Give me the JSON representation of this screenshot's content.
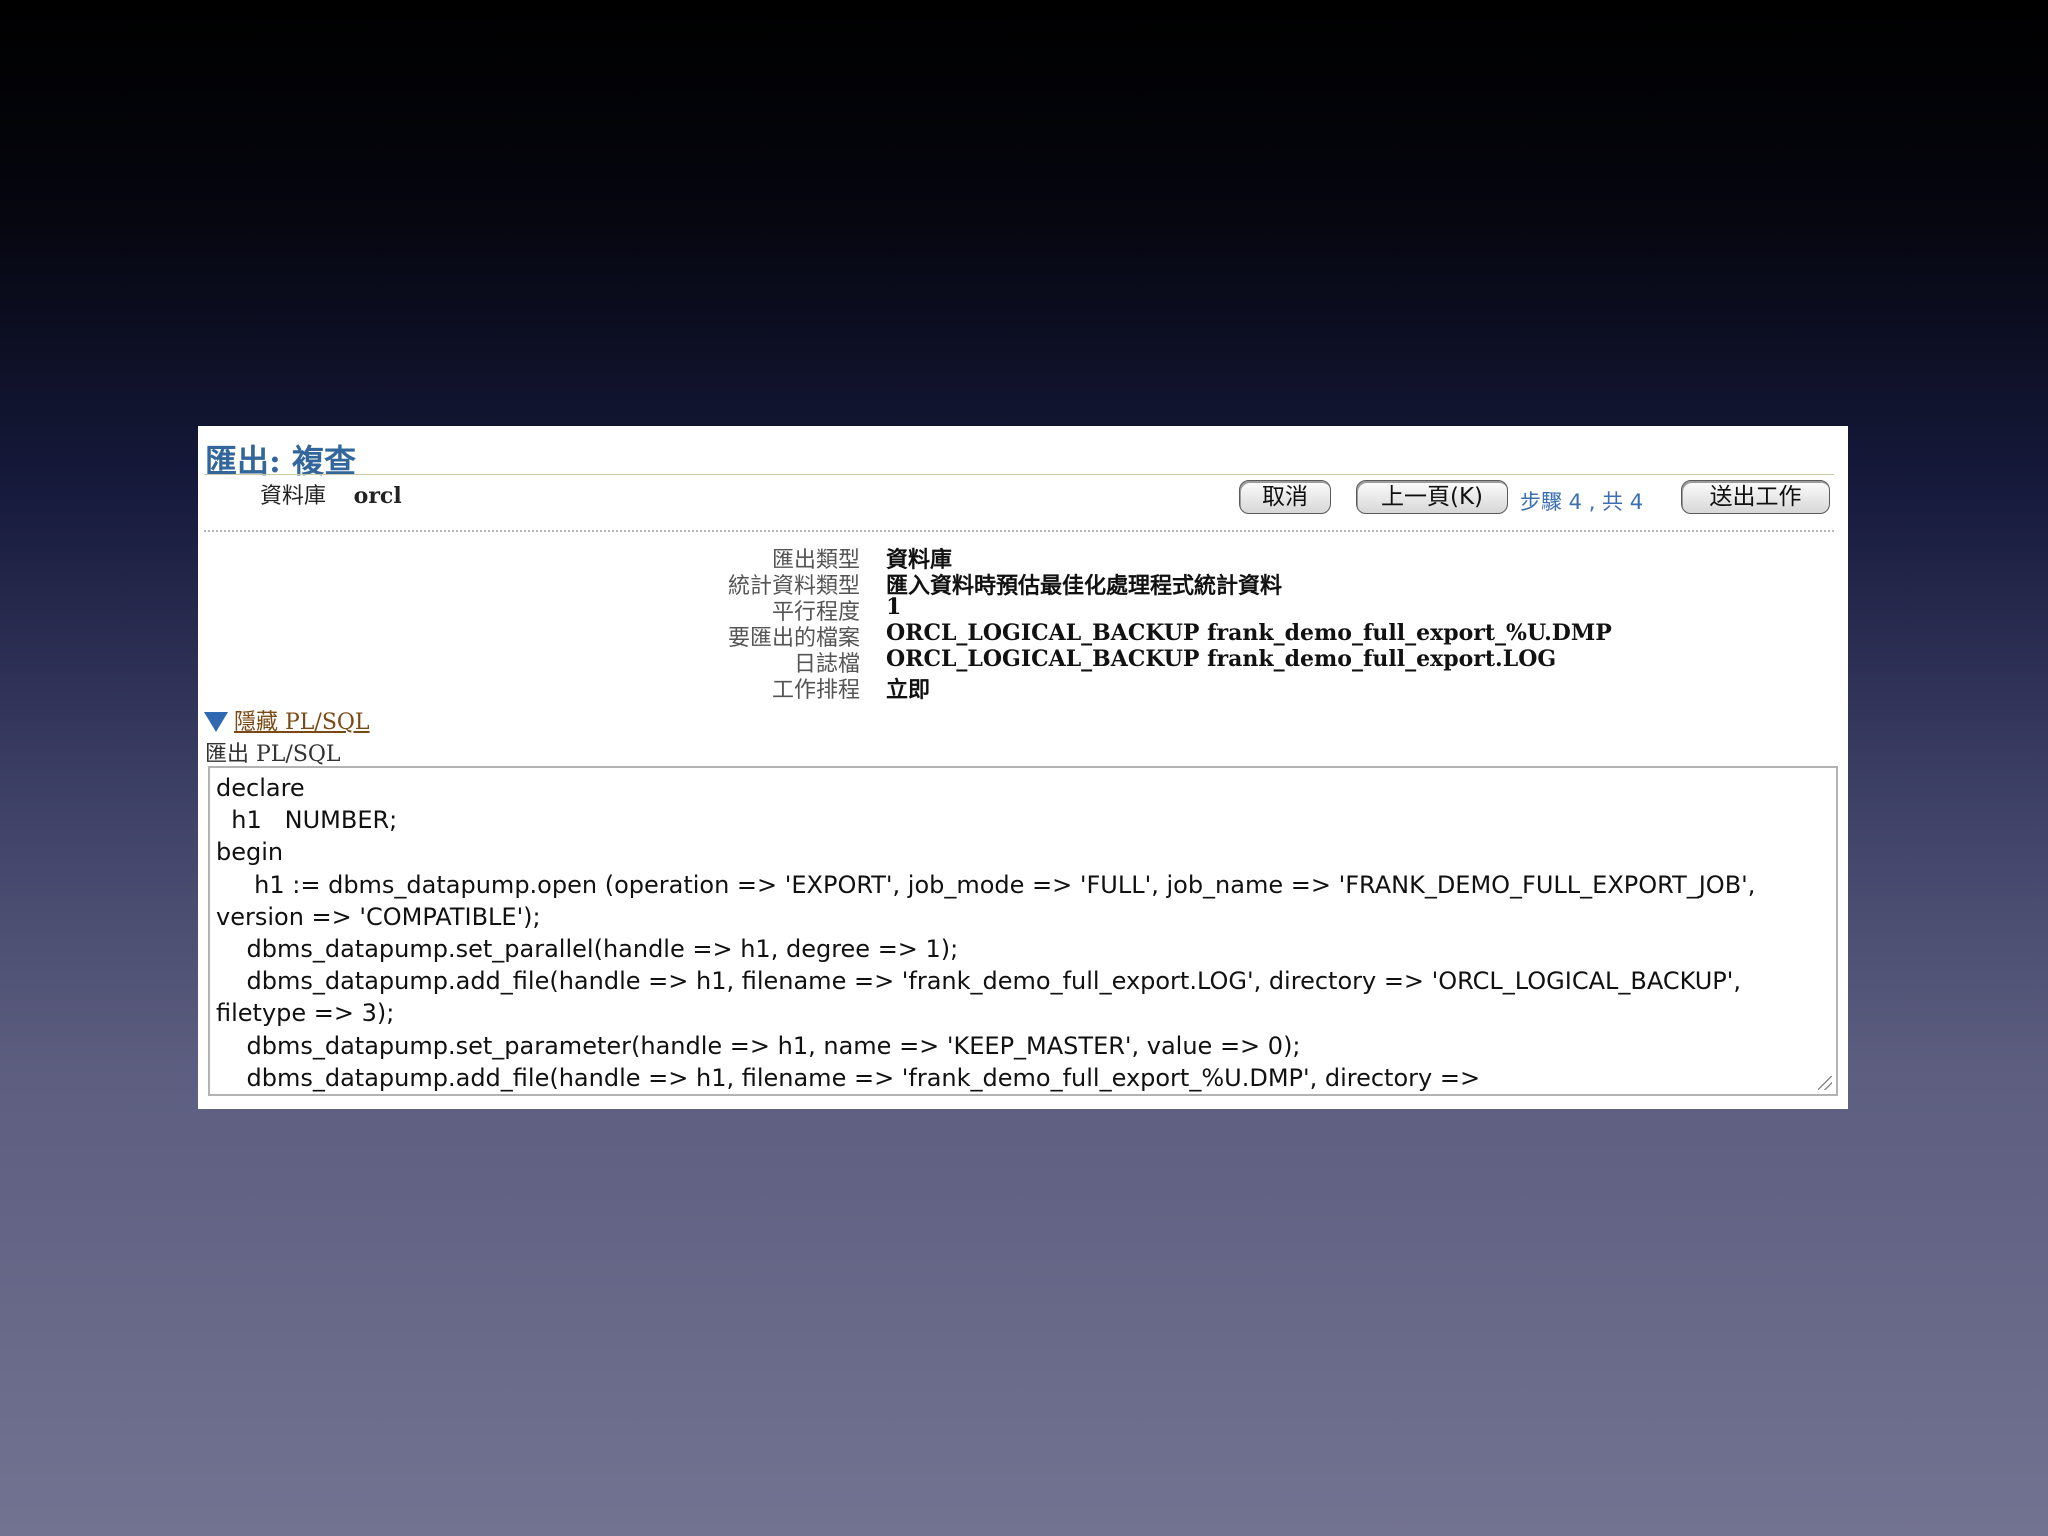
{
  "page": {
    "title": "匯出: 複查",
    "database_label": "資料庫",
    "database_value": "orcl"
  },
  "toolbar": {
    "cancel_label": "取消",
    "back_label": "上一頁(K)",
    "step_text": "步驟 4 , 共 4",
    "submit_label": "送出工作"
  },
  "summary": [
    {
      "label": "匯出類型",
      "value": "資料庫"
    },
    {
      "label": "統計資料類型",
      "value": "匯入資料時預估最佳化處理程式統計資料"
    },
    {
      "label": "平行程度",
      "value": "1"
    },
    {
      "label": "要匯出的檔案",
      "value": "ORCL_LOGICAL_BACKUP frank_demo_full_export_%U.DMP"
    },
    {
      "label": "日誌檔",
      "value": "ORCL_LOGICAL_BACKUP frank_demo_full_export.LOG"
    },
    {
      "label": "工作排程",
      "value": "立即"
    }
  ],
  "plsql": {
    "toggle_label": "隱藏 PL/SQL",
    "section_label": "匯出 PL/SQL",
    "lines": [
      "declare",
      "  h1   NUMBER;",
      "begin",
      "     h1 := dbms_datapump.open (operation => 'EXPORT', job_mode => 'FULL', job_name => 'FRANK_DEMO_FULL_EXPORT_JOB',",
      "version => 'COMPATIBLE');",
      "    dbms_datapump.set_parallel(handle => h1, degree => 1);",
      "    dbms_datapump.add_file(handle => h1, filename => 'frank_demo_full_export.LOG', directory => 'ORCL_LOGICAL_BACKUP',",
      "filetype => 3);",
      "    dbms_datapump.set_parameter(handle => h1, name => 'KEEP_MASTER', value => 0);",
      "    dbms_datapump.add_file(handle => h1, filename => 'frank_demo_full_export_%U.DMP', directory =>"
    ]
  },
  "colors": {
    "title": "#33669a",
    "step_text": "#3b6fb0",
    "toggle_icon": "#2e69b2",
    "link": "#7a4a16"
  },
  "icons": {
    "toggle": "triangle-down-icon",
    "resize": "resize-grip-icon"
  }
}
